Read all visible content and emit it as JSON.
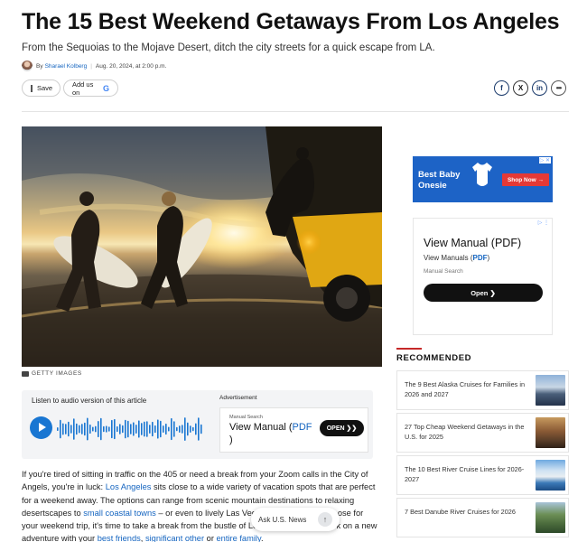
{
  "article": {
    "title": "The 15 Best Weekend Getaways From Los Angeles",
    "subtitle": "From the Sequoias to the Mojave Desert, ditch the city streets for a quick escape from LA.",
    "byline_prefix": "By",
    "author": "Sharael Kolberg",
    "date": "Aug. 20, 2024, at 2:00 p.m.",
    "save_label": "Save",
    "add_us_label": "Add us on",
    "add_us_logo": "G",
    "image_credit": "GETTY IMAGES"
  },
  "share": {
    "facebook": "f",
    "x": "X",
    "linkedin": "in",
    "more": "•••"
  },
  "audio": {
    "label": "Listen to audio version of this article",
    "ad_label": "Advertisement"
  },
  "inline_ad": {
    "source": "Manual Search",
    "headline_1": "View Manual (",
    "headline_pdf": "PDF",
    "headline_2": ")",
    "button": "OPEN ❯❯"
  },
  "body": {
    "p1_a": "If you're tired of sitting in traffic on the 405 or need a break from your Zoom calls in the City of Angels, you're in luck: ",
    "link_la": "Los Angeles",
    "p1_b": " sits close to a wide variety of vacation spots that are perfect for a weekend away. The options can range from scenic mountain destinations to relaxing desertscapes to ",
    "link_coastal": "small coastal towns",
    "p1_c": " – or even to lively Las Vegas. Whatever you choose for your weekend trip, it's time to take a break from the bustle of Los Angeles and embark on a new adventure with your ",
    "link_friends": "best friends",
    "comma": ", ",
    "link_other": "significant other",
    "or": " or ",
    "link_family": "entire family",
    "end": "."
  },
  "ask": {
    "label": "Ask U.S. News",
    "arrow": "↑"
  },
  "sidebar_ad1": {
    "line1": "Best Baby",
    "line2": "Onesie",
    "button": "Shop Now  →",
    "choice": "▷ ✕"
  },
  "sidebar_ad2": {
    "headline": "View Manual (PDF)",
    "sub_1": "View Manuals (",
    "sub_pdf": "PDF",
    "sub_2": ")",
    "source": "Manual Search",
    "button": "Open  ❯",
    "choice": "▷ ⋮"
  },
  "recommended": {
    "heading": "RECOMMENDED",
    "items": [
      {
        "title": "The 9 Best Alaska Cruises for Families in 2026 and 2027"
      },
      {
        "title": "27 Top Cheap Weekend Getaways in the U.S. for 2025"
      },
      {
        "title": "The 10 Best River Cruise Lines for 2026-2027"
      },
      {
        "title": "7 Best Danube River Cruises for 2026"
      }
    ]
  }
}
